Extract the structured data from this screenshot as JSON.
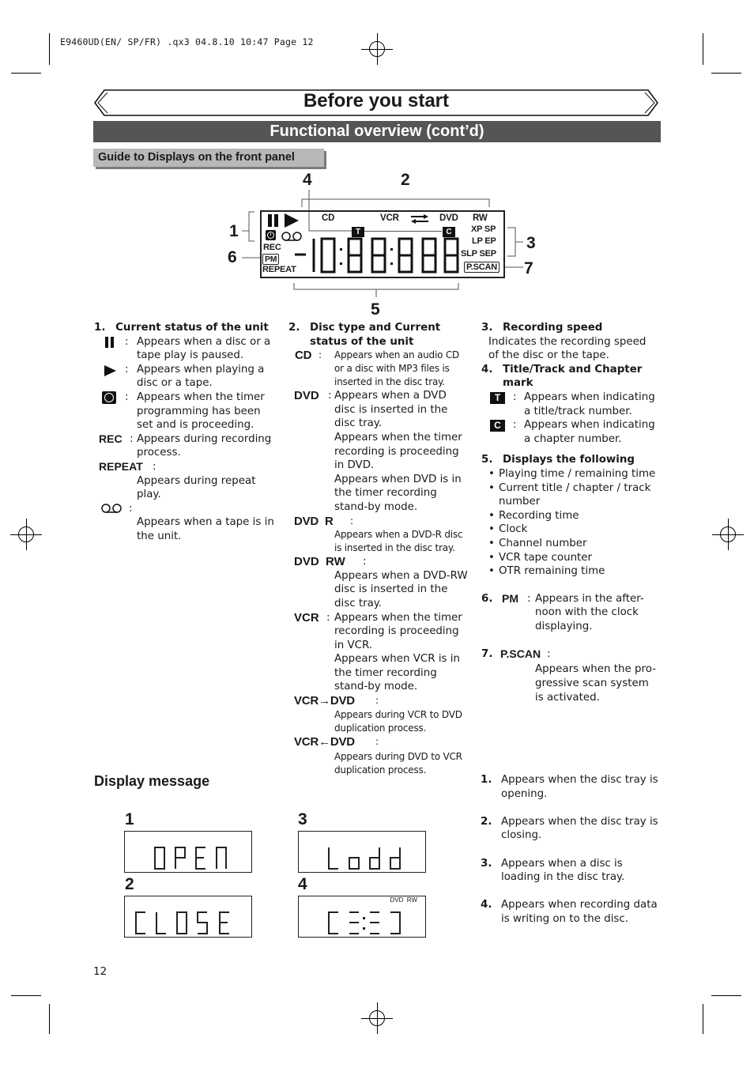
{
  "print_slug": "E9460UD(EN/ SP/FR)   .qx3  04.8.10  10:47  Page 12",
  "page_title": "Before you start",
  "section_title": "Functional overview (cont’d)",
  "subsection_tab": "Guide to Displays on the front panel",
  "display_panel": {
    "callouts": [
      "1",
      "2",
      "3",
      "4",
      "5",
      "6",
      "7"
    ],
    "labels": {
      "cd": "CD",
      "vcr": "VCR",
      "dvd": "DVD",
      "rw": "RW",
      "xp_sp": "XP SP",
      "lp_ep": "LP EP",
      "slp_sep": "SLP SEP",
      "rec": "REC",
      "pm": "PM",
      "repeat": "REPEAT",
      "pscan": "P.SCAN",
      "title_mark": "T",
      "chapter_mark": "C"
    },
    "segment_readout": "-10:88:88"
  },
  "column1": {
    "heading_num": "1.",
    "heading": "Current status of the unit",
    "items": [
      {
        "symbol": "pause-icon",
        "sep": ":",
        "text": "Appears when a disc or a tape play is paused."
      },
      {
        "symbol": "play-icon",
        "sep": ":",
        "text": "Appears when playing a disc or a tape."
      },
      {
        "symbol": "timer-icon",
        "sep": ":",
        "text": "Appears when the timer programming has been set and is proceeding."
      },
      {
        "symbol_text": "REC",
        "sep": ":",
        "text": "Appears during recording process."
      },
      {
        "symbol_text": "REPEAT",
        "sep": ":",
        "text": "Appears during repeat play."
      },
      {
        "symbol": "tape-icon",
        "sep": ":",
        "text": "Appears when a tape is in the unit."
      }
    ]
  },
  "column2": {
    "heading_num": "2.",
    "heading": "Disc type and Current status of the unit",
    "items": [
      {
        "symbol_text": "CD",
        "sep": ":",
        "text": "Appears when an audio CD or a disc with MP3 files is inserted in the disc tray."
      },
      {
        "symbol_text": "DVD",
        "sep": ":",
        "text": "Appears when a DVD disc is inserted in the disc tray.",
        "text2": "Appears when the timer recording is proceeding in DVD.",
        "text3": "Appears when DVD is in the timer recording stand-by mode."
      },
      {
        "symbol_text": "DVD  R",
        "sep": ":",
        "text": "Appears when a DVD-R disc is inserted in the disc tray."
      },
      {
        "symbol_text": "DVD  RW",
        "sep": ":",
        "text": "Appears when a DVD-RW disc is inserted in the disc tray."
      },
      {
        "symbol_text": "VCR",
        "sep": ":",
        "text": "Appears when the timer recording is proceeding in VCR.",
        "text2": "Appears when VCR is in the timer recording stand-by mode."
      },
      {
        "symbol_text": "VCR→DVD",
        "sep": ":",
        "text": "Appears during VCR to DVD duplication process."
      },
      {
        "symbol_text": "VCR←DVD",
        "sep": ":",
        "text": "Appears during DVD to VCR duplication process."
      }
    ]
  },
  "column3": {
    "sec3": {
      "num": "3.",
      "heading": "Recording speed",
      "text": "Indicates the recording speed of the disc or the tape."
    },
    "sec4": {
      "num": "4.",
      "heading": "Title/Track and Chapter mark",
      "items": [
        {
          "symbol": "T",
          "sep": ":",
          "text": "Appears when indicating a title/track number."
        },
        {
          "symbol": "C",
          "sep": ":",
          "text": "Appears when indicating a chapter number."
        }
      ]
    },
    "sec5": {
      "num": "5.",
      "heading": "Displays the following",
      "bullets": [
        "Playing time / remaining time",
        "Current title / chapter / track number",
        "Recording time",
        "Clock",
        "Channel number",
        "VCR tape counter",
        "OTR remaining time"
      ]
    },
    "sec6": {
      "num": "6.",
      "symbol": "PM",
      "sep": ":",
      "text": "Appears in the after-noon with the clock displaying."
    },
    "sec7": {
      "num": "7.",
      "symbol": "P.SCAN",
      "sep": ":",
      "text": "Appears when the pro-gressive scan system is activated."
    }
  },
  "display_message": {
    "heading": "Display message",
    "boxes": [
      {
        "num": "1",
        "readout": "OPEN"
      },
      {
        "num": "2",
        "readout": "CLOSE"
      },
      {
        "num": "3",
        "readout": "Lodd"
      },
      {
        "num": "4",
        "readout": "[=:=]",
        "indicators": "DVD  RW"
      }
    ],
    "descriptions": [
      {
        "num": "1.",
        "text": "Appears when the disc tray is opening."
      },
      {
        "num": "2.",
        "text": "Appears when the disc tray is closing."
      },
      {
        "num": "3.",
        "text": "Appears when a disc is loading in the disc tray."
      },
      {
        "num": "4.",
        "text": "Appears when recording data is writing on to the disc."
      }
    ]
  },
  "page_number": "12"
}
